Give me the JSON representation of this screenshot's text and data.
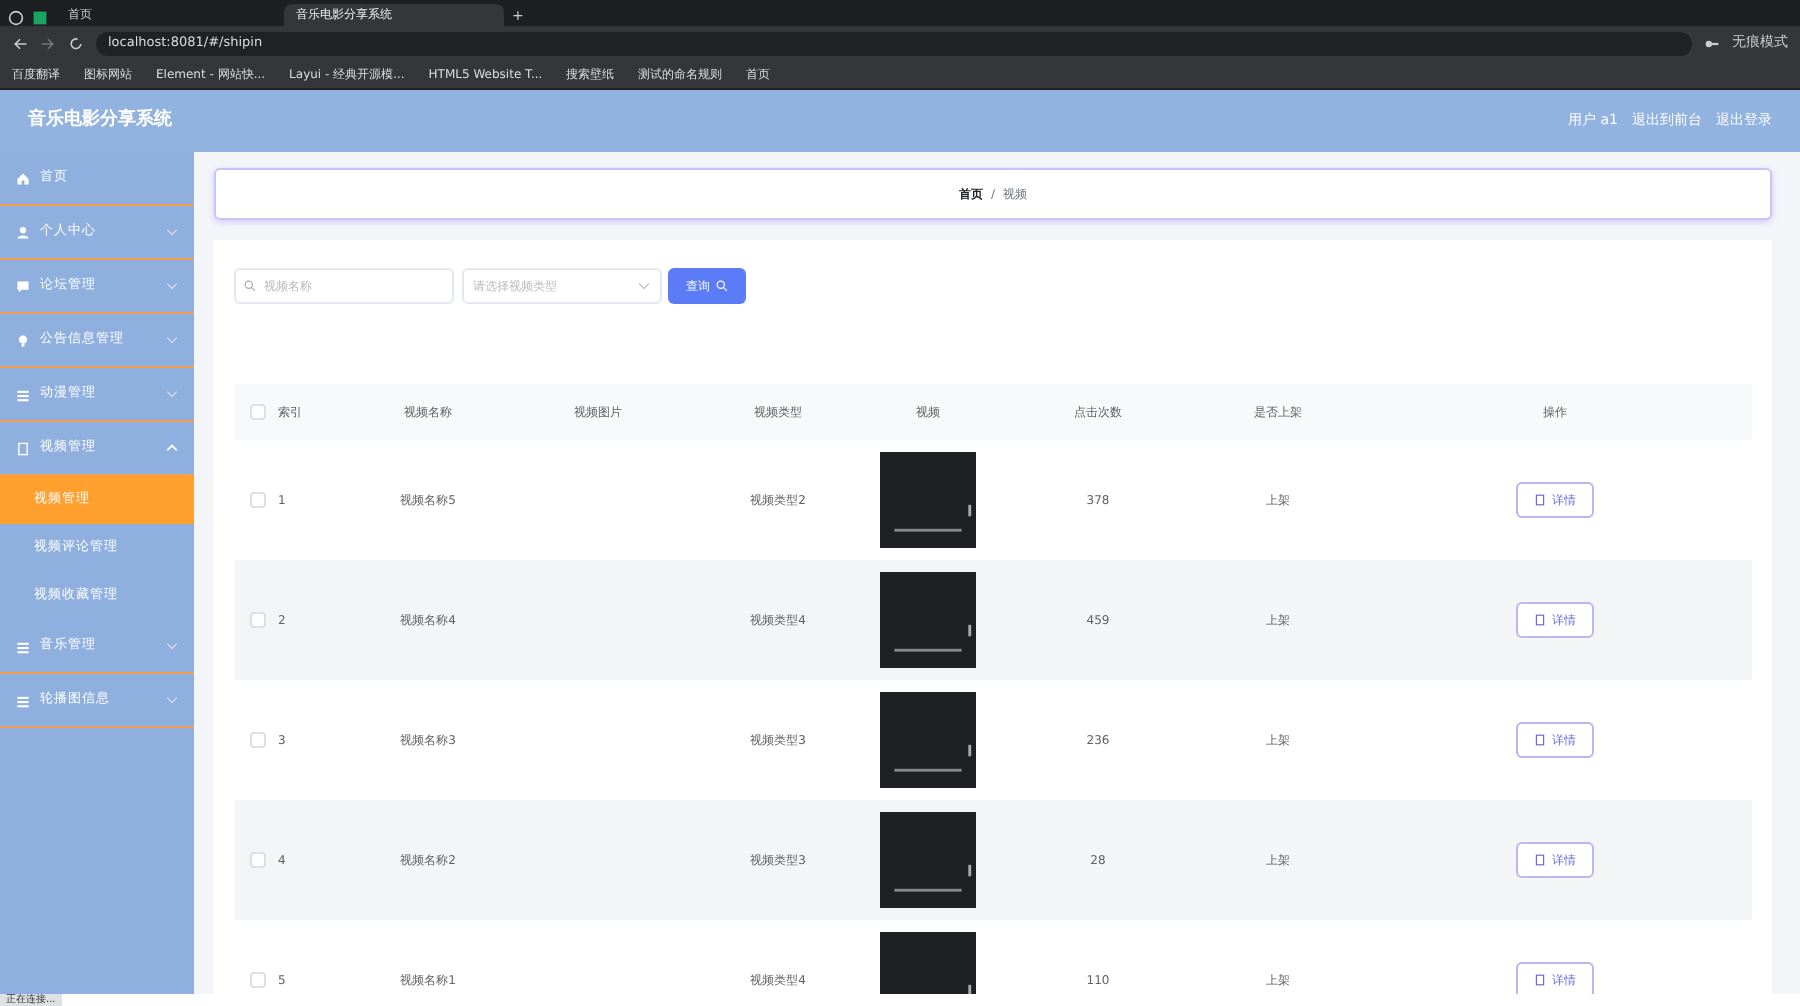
{
  "browser": {
    "tabs": [
      {
        "label": "首页",
        "selected": false
      },
      {
        "label": "音乐电影分享系统",
        "selected": true
      }
    ],
    "new_tab": "+",
    "address": "localhost:8081/#/shipin",
    "bookmarks": [
      "百度翻译",
      "图标网站",
      "Element - 网站快...",
      "Layui - 经典开源模...",
      "HTML5 Website T...",
      "搜索壁纸",
      "测试的命名规则",
      "首页"
    ],
    "profile": "无痕模式"
  },
  "header": {
    "title": "音乐电影分享系统",
    "links": [
      "用户 a1",
      "退出到前台",
      "退出登录"
    ]
  },
  "sidebar": {
    "items": [
      {
        "label": "首页"
      },
      {
        "label": "个人中心",
        "expanded": false
      },
      {
        "label": "论坛管理",
        "expanded": false
      },
      {
        "label": "公告信息管理",
        "expanded": false
      },
      {
        "label": "动漫管理",
        "expanded": false
      },
      {
        "label": "视频管理",
        "expanded": true,
        "children": [
          {
            "label": "视频管理",
            "selected": true
          },
          {
            "label": "视频评论管理",
            "selected": false
          },
          {
            "label": "视频收藏管理",
            "selected": false
          }
        ]
      },
      {
        "label": "音乐管理",
        "expanded": false
      },
      {
        "label": "轮播图信息",
        "expanded": false
      }
    ]
  },
  "breadcrumb": {
    "items": [
      "首页",
      "视频"
    ],
    "separator": "/"
  },
  "search": {
    "placeholder": "视频名称",
    "type_placeholder": "请选择视频类型",
    "button": "查询"
  },
  "table": {
    "header_checked": false,
    "columns": [
      "索引",
      "视频名称",
      "视频图片",
      "视频类型",
      "视频",
      "点击次数",
      "是否上架",
      "操作"
    ],
    "rows": [
      {
        "checked": false,
        "index": "1",
        "name": "视频名称5",
        "type": "视频类型2",
        "clicks": "378",
        "shelf": "上架",
        "action": "详情"
      },
      {
        "checked": false,
        "index": "2",
        "name": "视频名称4",
        "type": "视频类型4",
        "clicks": "459",
        "shelf": "上架",
        "action": "详情"
      },
      {
        "checked": false,
        "index": "3",
        "name": "视频名称3",
        "type": "视频类型3",
        "clicks": "236",
        "shelf": "上架",
        "action": "详情"
      },
      {
        "checked": false,
        "index": "4",
        "name": "视频名称2",
        "type": "视频类型3",
        "clicks": "28",
        "shelf": "上架",
        "action": "详情"
      },
      {
        "checked": false,
        "index": "5",
        "name": "视频名称1",
        "type": "视频类型4",
        "clicks": "110",
        "shelf": "上架",
        "action": "详情"
      }
    ]
  },
  "status_bar": "正在连接..."
}
